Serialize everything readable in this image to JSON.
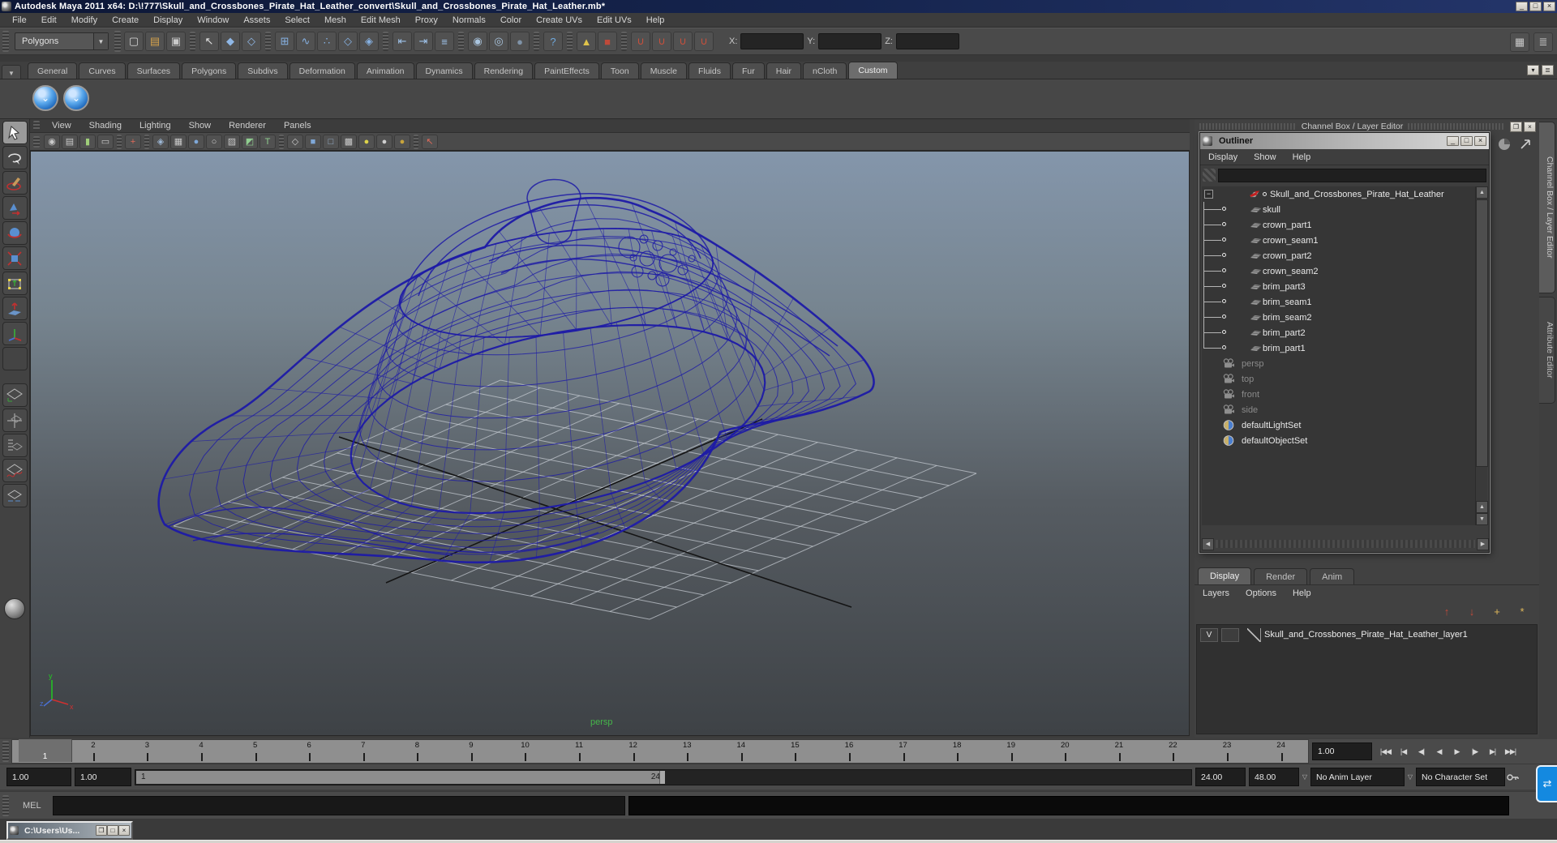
{
  "window": {
    "title": "Autodesk Maya 2011 x64: D:\\!777\\Skull_and_Crossbones_Pirate_Hat_Leather_convert\\Skull_and_Crossbones_Pirate_Hat_Leather.mb*",
    "buttons": {
      "minimize": "_",
      "maximize": "□",
      "close": "×"
    }
  },
  "menubar": {
    "items": [
      "File",
      "Edit",
      "Modify",
      "Create",
      "Display",
      "Window",
      "Assets",
      "Select",
      "Mesh",
      "Edit Mesh",
      "Proxy",
      "Normals",
      "Color",
      "Create UVs",
      "Edit UVs",
      "Help"
    ]
  },
  "statusline": {
    "selection_mode": "Polygons",
    "x_label": "X:",
    "y_label": "Y:",
    "z_label": "Z:",
    "x_value": "",
    "y_value": "",
    "z_value": "",
    "icons": [
      {
        "name": "new-scene-icon",
        "glyph": "▢",
        "color": "#d8d8d8"
      },
      {
        "name": "open-scene-icon",
        "glyph": "▤",
        "color": "#d4a24c"
      },
      {
        "name": "save-scene-icon",
        "glyph": "▣",
        "color": "#c9c9c9"
      },
      {
        "name": "separator",
        "kind": "sep"
      },
      {
        "name": "select-hierarchy-icon",
        "glyph": "↖",
        "color": "#e2e2e2"
      },
      {
        "name": "select-object-icon",
        "glyph": "◆",
        "color": "#8fb7e6"
      },
      {
        "name": "select-component-icon",
        "glyph": "◇",
        "color": "#8fb7e6"
      },
      {
        "name": "separator",
        "kind": "sep"
      },
      {
        "name": "snap-grid-icon",
        "glyph": "⊞",
        "color": "#86b1e2"
      },
      {
        "name": "snap-curve-icon",
        "glyph": "∿",
        "color": "#86b1e2"
      },
      {
        "name": "snap-point-icon",
        "glyph": "∴",
        "color": "#86b1e2"
      },
      {
        "name": "snap-plane-icon",
        "glyph": "◇",
        "color": "#86b1e2"
      },
      {
        "name": "make-live-icon",
        "glyph": "◈",
        "color": "#86b1e2"
      },
      {
        "name": "separator",
        "kind": "sep"
      },
      {
        "name": "input-connections-icon",
        "glyph": "⇤",
        "color": "#9fc3ea"
      },
      {
        "name": "output-connections-icon",
        "glyph": "⇥",
        "color": "#9fc3ea"
      },
      {
        "name": "construction-history-icon",
        "glyph": "≡",
        "color": "#9fc3ea"
      },
      {
        "name": "separator",
        "kind": "sep"
      },
      {
        "name": "render-current-icon",
        "glyph": "◉",
        "color": "#a9c4de"
      },
      {
        "name": "ipr-render-icon",
        "glyph": "◎",
        "color": "#a9c4de"
      },
      {
        "name": "render-settings-icon",
        "glyph": "●",
        "color": "#7f93a8"
      },
      {
        "name": "separator",
        "kind": "sep"
      },
      {
        "name": "help-line-icon",
        "glyph": "?",
        "color": "#6fa8dc"
      },
      {
        "name": "separator",
        "kind": "sep"
      },
      {
        "name": "anim-key-lock-icon",
        "glyph": "▲",
        "color": "#e0c34a"
      },
      {
        "name": "auto-keyframe-icon",
        "glyph": "■",
        "color": "#c04a3a"
      },
      {
        "name": "separator",
        "kind": "sep"
      },
      {
        "name": "snap-magnet-1-icon",
        "glyph": "∪",
        "color": "#c8503c"
      },
      {
        "name": "snap-magnet-2-icon",
        "glyph": "∪",
        "color": "#c8503c"
      },
      {
        "name": "snap-magnet-3-icon",
        "glyph": "∪",
        "color": "#c8503c"
      },
      {
        "name": "snap-magnet-4-icon",
        "glyph": "∪",
        "color": "#c8503c"
      }
    ],
    "right_icons": [
      {
        "name": "toggle-channel-box-icon",
        "glyph": "▦",
        "color": "#c9c9c9"
      },
      {
        "name": "toggle-tool-settings-icon",
        "glyph": "≣",
        "color": "#c9c9c9"
      }
    ]
  },
  "shelf": {
    "tabs": [
      {
        "label": "General"
      },
      {
        "label": "Curves"
      },
      {
        "label": "Surfaces"
      },
      {
        "label": "Polygons"
      },
      {
        "label": "Subdivs"
      },
      {
        "label": "Deformation"
      },
      {
        "label": "Animation"
      },
      {
        "label": "Dynamics"
      },
      {
        "label": "Rendering"
      },
      {
        "label": "PaintEffects"
      },
      {
        "label": "Toon"
      },
      {
        "label": "Muscle"
      },
      {
        "label": "Fluids"
      },
      {
        "label": "Fur"
      },
      {
        "label": "Hair"
      },
      {
        "label": "nCloth"
      },
      {
        "label": "Custom",
        "active": true
      }
    ],
    "buttons": [
      {
        "name": "shelf-item-smooth-1",
        "glyph": "⌄"
      },
      {
        "name": "shelf-item-smooth-2",
        "glyph": "⌄"
      }
    ]
  },
  "viewport": {
    "menus": [
      "View",
      "Shading",
      "Lighting",
      "Show",
      "Renderer",
      "Panels"
    ],
    "camera_label": "persp",
    "toolbar_icons": [
      {
        "name": "camera-icon",
        "glyph": "◉",
        "color": "#c9c9c9"
      },
      {
        "name": "camera-attributes-icon",
        "glyph": "▤",
        "color": "#c9c9c9"
      },
      {
        "name": "bookmark-icon",
        "glyph": "▮",
        "color": "#9fce79"
      },
      {
        "name": "image-plane-icon",
        "glyph": "▭",
        "color": "#c9c9c9"
      },
      {
        "name": "separator",
        "kind": "sep"
      },
      {
        "name": "zoom-region-icon",
        "glyph": "+",
        "color": "#e06a5a"
      },
      {
        "name": "separator",
        "kind": "sep"
      },
      {
        "name": "wireframe-mode-icon",
        "glyph": "◈",
        "color": "#9db8d6"
      },
      {
        "name": "film-gate-icon",
        "glyph": "▦",
        "color": "#c9c9c9"
      },
      {
        "name": "shaded-mode-icon",
        "glyph": "●",
        "color": "#7fa8d8"
      },
      {
        "name": "highlight-mode-icon",
        "glyph": "○",
        "color": "#d0d0d0"
      },
      {
        "name": "xray-mode-icon",
        "glyph": "▨",
        "color": "#c9c9c9"
      },
      {
        "name": "vertex-color-icon",
        "glyph": "◩",
        "color": "#8fce8f"
      },
      {
        "name": "textured-mode-icon",
        "glyph": "T",
        "color": "#8fce8f"
      },
      {
        "name": "separator",
        "kind": "sep"
      },
      {
        "name": "default-material-icon",
        "glyph": "◇",
        "color": "#c9c9c9"
      },
      {
        "name": "shaded-cube-icon",
        "glyph": "■",
        "color": "#7fa8d8"
      },
      {
        "name": "textured-cube-icon",
        "glyph": "□",
        "color": "#9db8d6"
      },
      {
        "name": "checker-icon",
        "glyph": "▩",
        "color": "#c9c9c9"
      },
      {
        "name": "light-all-icon",
        "glyph": "●",
        "color": "#ddd34a"
      },
      {
        "name": "light-default-icon",
        "glyph": "●",
        "color": "#cfcfcf"
      },
      {
        "name": "light-selected-icon",
        "glyph": "●",
        "color": "#c8a43c"
      },
      {
        "name": "separator",
        "kind": "sep"
      },
      {
        "name": "isolate-select-icon",
        "glyph": "↖",
        "color": "#e06a5a"
      }
    ]
  },
  "right_panel": {
    "header": "Channel Box / Layer Editor",
    "vertical_tabs": {
      "tab1": "Channel Box / Layer Editor",
      "tab2": "Attribute Editor"
    }
  },
  "outliner": {
    "title": "Outliner",
    "menus": [
      "Display",
      "Show",
      "Help"
    ],
    "search_value": "",
    "items": [
      {
        "label": "Skull_and_Crossbones_Pirate_Hat_Leather",
        "icon": "transform",
        "root": true
      },
      {
        "label": "skull",
        "icon": "mesh",
        "child": true
      },
      {
        "label": "crown_part1",
        "icon": "mesh",
        "child": true
      },
      {
        "label": "crown_seam1",
        "icon": "mesh",
        "child": true
      },
      {
        "label": "crown_part2",
        "icon": "mesh",
        "child": true
      },
      {
        "label": "crown_seam2",
        "icon": "mesh",
        "child": true
      },
      {
        "label": "brim_part3",
        "icon": "mesh",
        "child": true
      },
      {
        "label": "brim_seam1",
        "icon": "mesh",
        "child": true
      },
      {
        "label": "brim_seam2",
        "icon": "mesh",
        "child": true
      },
      {
        "label": "brim_part2",
        "icon": "mesh",
        "child": true
      },
      {
        "label": "brim_part1",
        "icon": "mesh",
        "child": true,
        "last": true
      },
      {
        "label": "persp",
        "icon": "camera",
        "muted": true
      },
      {
        "label": "top",
        "icon": "camera",
        "muted": true
      },
      {
        "label": "front",
        "icon": "camera",
        "muted": true
      },
      {
        "label": "side",
        "icon": "camera",
        "muted": true
      },
      {
        "label": "defaultLightSet",
        "icon": "set"
      },
      {
        "label": "defaultObjectSet",
        "icon": "set"
      }
    ]
  },
  "layer_editor": {
    "tabs": [
      {
        "label": "Display",
        "active": true
      },
      {
        "label": "Render"
      },
      {
        "label": "Anim"
      }
    ],
    "menus": [
      "Layers",
      "Options",
      "Help"
    ],
    "icons": [
      {
        "name": "layer-move-up-icon",
        "glyph": "↑",
        "color": "#c04a3a"
      },
      {
        "name": "layer-move-down-icon",
        "glyph": "↓",
        "color": "#c04a3a"
      },
      {
        "name": "create-empty-layer-icon",
        "glyph": "+",
        "color": "#e0b85a"
      },
      {
        "name": "create-layer-from-selected-icon",
        "glyph": "*",
        "color": "#e0b85a"
      }
    ],
    "layers": [
      {
        "visible": "V",
        "label": "Skull_and_Crossbones_Pirate_Hat_Leather_layer1"
      }
    ]
  },
  "timeline": {
    "frames": [
      "1",
      "2",
      "3",
      "4",
      "5",
      "6",
      "7",
      "8",
      "9",
      "10",
      "11",
      "12",
      "13",
      "14",
      "15",
      "16",
      "17",
      "18",
      "19",
      "20",
      "21",
      "22",
      "23",
      "24"
    ],
    "current_frame": "1",
    "current_frame_field": "1.00",
    "playback_buttons": [
      {
        "name": "go-to-range-start-button",
        "glyph": "|◀◀"
      },
      {
        "name": "step-back-frame-button",
        "glyph": "|◀"
      },
      {
        "name": "step-back-key-button",
        "glyph": "◀|"
      },
      {
        "name": "play-backwards-button",
        "glyph": "◀"
      },
      {
        "name": "play-forwards-button",
        "glyph": "▶"
      },
      {
        "name": "step-forward-key-button",
        "glyph": "|▶"
      },
      {
        "name": "step-forward-frame-button",
        "glyph": "▶|"
      },
      {
        "name": "go-to-range-end-button",
        "glyph": "▶▶|"
      }
    ]
  },
  "range_slider": {
    "anim_start_field": "1.00",
    "playback_start_field": "1.00",
    "bar_start_label": "1",
    "bar_end_label": "24",
    "playback_end_field": "24.00",
    "anim_end_field": "48.00",
    "anim_layer": "No Anim Layer",
    "character_set": "No Character Set"
  },
  "command_line": {
    "label": "MEL",
    "value": ""
  },
  "taskbar": {
    "item_label": "C:\\Users\\Us..."
  },
  "colors": {
    "wireframe": "#1d1aa6",
    "viewport_top": "#8496ab",
    "viewport_bottom": "#3e4246",
    "grid_line": "#c8cdd4",
    "persp_label_green": "#46b54a",
    "titlebar_blue": "#16254f",
    "shelf_button_blue": "#1a63b8"
  }
}
